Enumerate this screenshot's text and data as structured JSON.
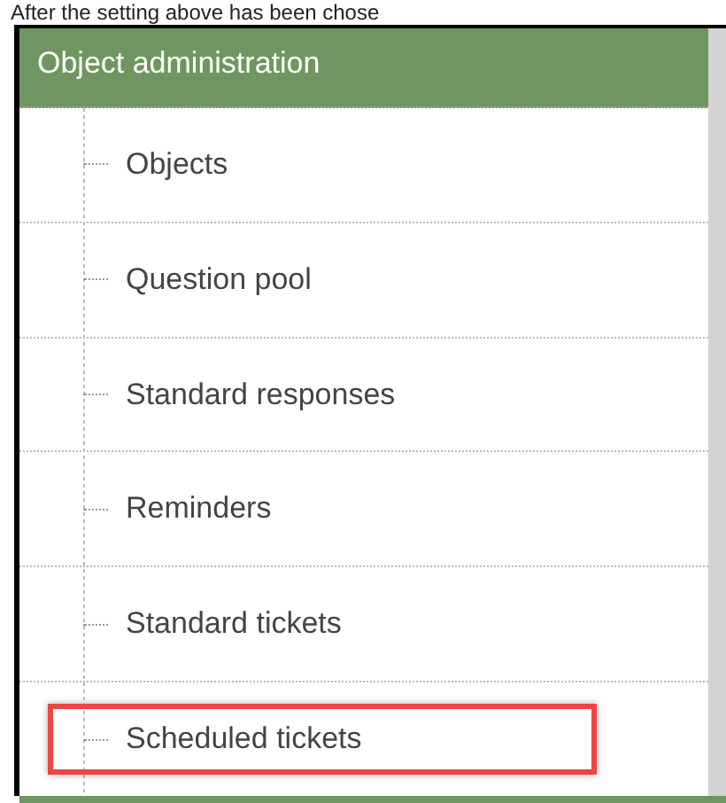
{
  "caption": "After the setting above has been chose",
  "panel": {
    "title": "Object administration",
    "items": [
      {
        "label": "Objects",
        "highlighted": false
      },
      {
        "label": "Question pool",
        "highlighted": false
      },
      {
        "label": "Standard responses",
        "highlighted": false
      },
      {
        "label": "Reminders",
        "highlighted": false
      },
      {
        "label": "Standard tickets",
        "highlighted": false
      },
      {
        "label": "Scheduled tickets",
        "highlighted": true
      }
    ]
  }
}
